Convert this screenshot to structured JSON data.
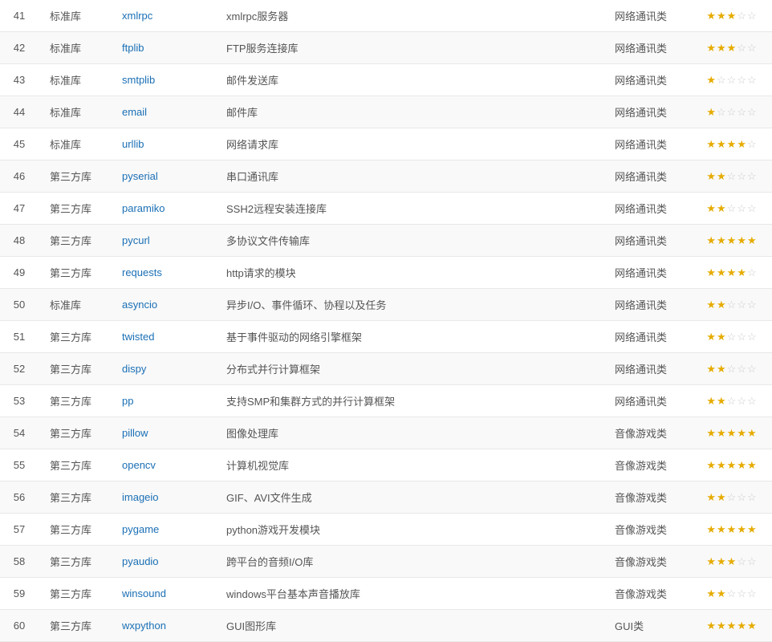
{
  "rows": [
    {
      "num": 41,
      "type": "标准库",
      "name": "xmlrpc",
      "desc": "xmlrpc服务器",
      "category": "网络通讯类",
      "stars": 3
    },
    {
      "num": 42,
      "type": "标准库",
      "name": "ftplib",
      "desc": "FTP服务连接库",
      "category": "网络通讯类",
      "stars": 3
    },
    {
      "num": 43,
      "type": "标准库",
      "name": "smtplib",
      "desc": "邮件发送库",
      "category": "网络通讯类",
      "stars": 1
    },
    {
      "num": 44,
      "type": "标准库",
      "name": "email",
      "desc": "邮件库",
      "category": "网络通讯类",
      "stars": 1
    },
    {
      "num": 45,
      "type": "标准库",
      "name": "urllib",
      "desc": "网络请求库",
      "category": "网络通讯类",
      "stars": 4
    },
    {
      "num": 46,
      "type": "第三方库",
      "name": "pyserial",
      "desc": "串口通讯库",
      "category": "网络通讯类",
      "stars": 2
    },
    {
      "num": 47,
      "type": "第三方库",
      "name": "paramiko",
      "desc": "SSH2远程安装连接库",
      "category": "网络通讯类",
      "stars": 2
    },
    {
      "num": 48,
      "type": "第三方库",
      "name": "pycurl",
      "desc": "多协议文件传输库",
      "category": "网络通讯类",
      "stars": 5
    },
    {
      "num": 49,
      "type": "第三方库",
      "name": "requests",
      "desc": "http请求的模块",
      "category": "网络通讯类",
      "stars": 4
    },
    {
      "num": 50,
      "type": "标准库",
      "name": "asyncio",
      "desc": "异步I/O、事件循环、协程以及任务",
      "category": "网络通讯类",
      "stars": 2
    },
    {
      "num": 51,
      "type": "第三方库",
      "name": "twisted",
      "desc": "基于事件驱动的网络引擎框架",
      "category": "网络通讯类",
      "stars": 2
    },
    {
      "num": 52,
      "type": "第三方库",
      "name": "dispy",
      "desc": "分布式并行计算框架",
      "category": "网络通讯类",
      "stars": 2
    },
    {
      "num": 53,
      "type": "第三方库",
      "name": "pp",
      "desc": "支持SMP和集群方式的并行计算框架",
      "category": "网络通讯类",
      "stars": 2
    },
    {
      "num": 54,
      "type": "第三方库",
      "name": "pillow",
      "desc": "图像处理库",
      "category": "音像游戏类",
      "stars": 5
    },
    {
      "num": 55,
      "type": "第三方库",
      "name": "opencv",
      "desc": "计算机视觉库",
      "category": "音像游戏类",
      "stars": 5
    },
    {
      "num": 56,
      "type": "第三方库",
      "name": "imageio",
      "desc": "GIF、AVI文件生成",
      "category": "音像游戏类",
      "stars": 2
    },
    {
      "num": 57,
      "type": "第三方库",
      "name": "pygame",
      "desc": "python游戏开发模块",
      "category": "音像游戏类",
      "stars": 5
    },
    {
      "num": 58,
      "type": "第三方库",
      "name": "pyaudio",
      "desc": "跨平台的音频I/O库",
      "category": "音像游戏类",
      "stars": 3
    },
    {
      "num": 59,
      "type": "第三方库",
      "name": "winsound",
      "desc": "windows平台基本声音播放库",
      "category": "音像游戏类",
      "stars": 2
    },
    {
      "num": 60,
      "type": "第三方库",
      "name": "wxpython",
      "desc": "GUI图形库",
      "category": "GUI类",
      "stars": 5
    }
  ],
  "starMax": 5
}
